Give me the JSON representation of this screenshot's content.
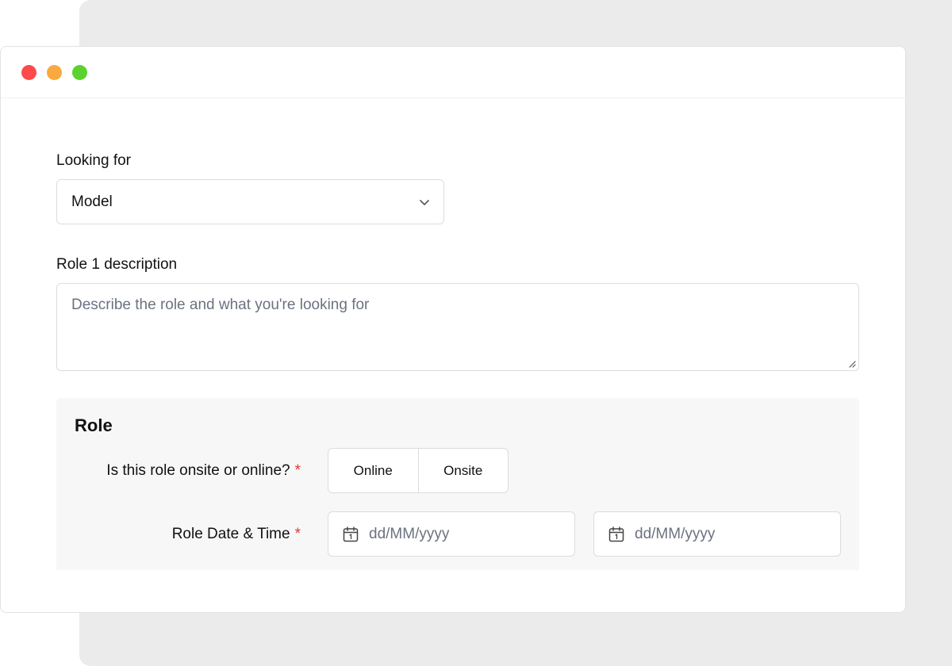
{
  "window": {
    "controls": [
      {
        "name": "close",
        "color": "#fe4a4a"
      },
      {
        "name": "minimize",
        "color": "#f9a93d"
      },
      {
        "name": "maximize",
        "color": "#5ad32e"
      }
    ]
  },
  "looking_for": {
    "label": "Looking for",
    "selected": "Model",
    "icon": "chevron-down-icon"
  },
  "role_description": {
    "label": "Role 1 description",
    "placeholder": "Describe the role and what you're looking for"
  },
  "role_section": {
    "title": "Role",
    "location_question": {
      "label": "Is this role onsite or online?",
      "required_mark": "*",
      "options": [
        "Online",
        "Onsite"
      ]
    },
    "date_time": {
      "label": "Role Date & Time",
      "required_mark": "*",
      "start_placeholder": "dd/MM/yyyy",
      "end_placeholder": "dd/MM/yyyy",
      "icon": "calendar-icon"
    }
  },
  "colors": {
    "required": "#e0363a",
    "panel_background": "#f7f7f7",
    "border": "#dcdcdc",
    "placeholder": "#6b7280"
  }
}
